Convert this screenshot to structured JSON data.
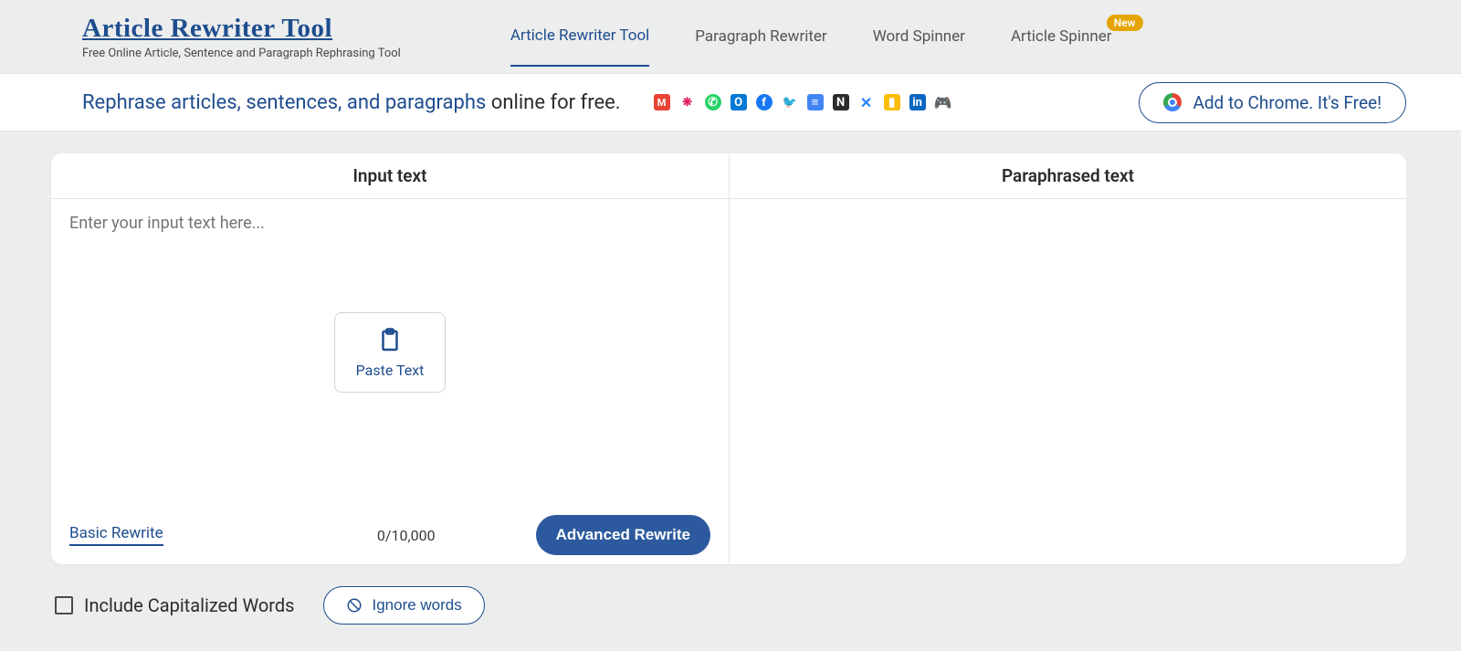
{
  "brand": {
    "title": "Article Rewriter Tool",
    "subtitle": "Free Online Article, Sentence and Paragraph Rephrasing Tool"
  },
  "nav": {
    "items": [
      {
        "label": "Article Rewriter Tool",
        "active": true
      },
      {
        "label": "Paragraph Rewriter"
      },
      {
        "label": "Word Spinner"
      },
      {
        "label": "Article Spinner",
        "badge": "New"
      }
    ]
  },
  "tagline": {
    "prefix": "Rephrase articles, sentences, and paragraphs ",
    "suffix": "online for free."
  },
  "appicons": [
    "gmail",
    "slack",
    "whatsapp",
    "outlook",
    "facebook",
    "twitter",
    "docs",
    "notion",
    "confluence",
    "keep",
    "linkedin",
    "discord"
  ],
  "chrome_button": "Add to Chrome. It's Free!",
  "panel": {
    "input_header": "Input text",
    "output_header": "Paraphrased text",
    "placeholder": "Enter your input text here...",
    "paste_label": "Paste Text",
    "basic_label": "Basic Rewrite",
    "counter": "0/10,000",
    "advanced_label": "Advanced Rewrite"
  },
  "bottom": {
    "capitalized_label": "Include Capitalized Words",
    "ignore_label": "Ignore words"
  }
}
